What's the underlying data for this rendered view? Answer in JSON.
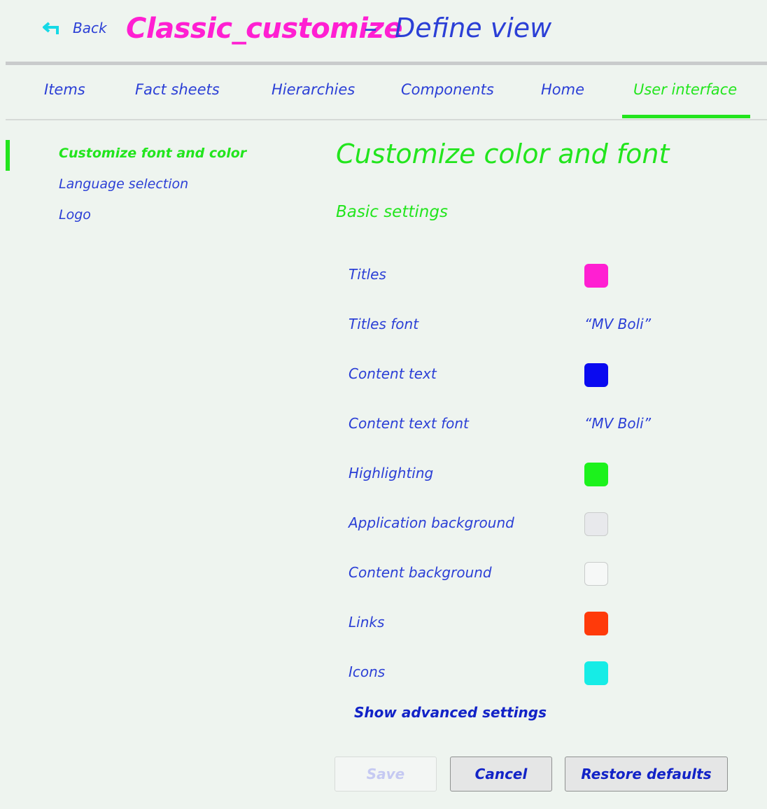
{
  "header": {
    "back_label": "Back",
    "app_name": "Classic_customize",
    "separator": "–",
    "view_title": "Define view"
  },
  "tabs": [
    {
      "label": "Items",
      "active": false
    },
    {
      "label": "Fact sheets",
      "active": false
    },
    {
      "label": "Hierarchies",
      "active": false
    },
    {
      "label": "Components",
      "active": false
    },
    {
      "label": "Home",
      "active": false
    },
    {
      "label": "User interface",
      "active": true
    }
  ],
  "sidebar": {
    "items": [
      {
        "label": "Customize font and color",
        "active": true
      },
      {
        "label": "Language selection",
        "active": false
      },
      {
        "label": "Logo",
        "active": false
      }
    ]
  },
  "main": {
    "title": "Customize color and font",
    "section": "Basic settings",
    "settings": [
      {
        "label": "Titles",
        "type": "color",
        "color": "#ff1fd2"
      },
      {
        "label": "Titles font",
        "type": "font",
        "value": "“MV Boli”"
      },
      {
        "label": "Content text",
        "type": "color",
        "color": "#0a0af0"
      },
      {
        "label": "Content text font",
        "type": "font",
        "value": "“MV Boli”"
      },
      {
        "label": "Highlighting",
        "type": "color",
        "color": "#1cf21c"
      },
      {
        "label": "Application background",
        "type": "color",
        "color": "#e8e9ec"
      },
      {
        "label": "Content background",
        "type": "color",
        "color": "#f6f8f7"
      },
      {
        "label": "Links",
        "type": "color",
        "color": "#ff3a0a"
      },
      {
        "label": "Icons",
        "type": "color",
        "color": "#16ece6"
      }
    ],
    "advanced_link": "Show advanced settings"
  },
  "buttons": {
    "save": "Save",
    "cancel": "Cancel",
    "restore": "Restore defaults"
  },
  "colors": {
    "accent_green": "#22e51d",
    "title_magenta": "#ff1fd2",
    "text_blue": "#2b3fd6",
    "back_icon": "#16d9e6"
  }
}
